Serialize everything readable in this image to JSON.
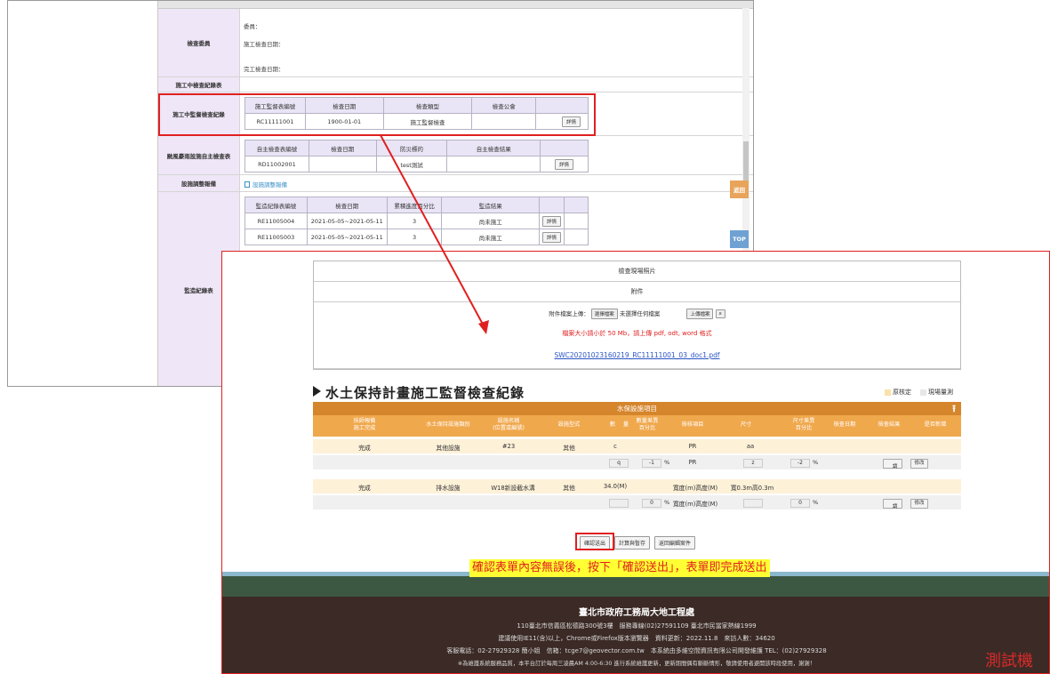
{
  "back": {
    "inspector_label": "檢查委員",
    "inspector_lines": [
      "委員：",
      "施工檢查日期：",
      "完工檢查日期："
    ],
    "construction_record_label": "施工中檢查紀錄表",
    "supervision_label": "施工中監督檢查紀錄",
    "supervision_headers": [
      "施工監督表編號",
      "檢查日期",
      "檢查類型",
      "檢查公會",
      ""
    ],
    "supervision_row": [
      "RC11111001",
      "1900-01-01",
      "施工監督檢查",
      "",
      "詳情"
    ],
    "disaster_label": "颱風豪雨設施自主檢查表",
    "disaster_headers": [
      "自主檢查表編號",
      "檢查日期",
      "防災標的",
      "自主檢查結果",
      ""
    ],
    "disaster_row": [
      "RD11002001",
      "",
      "test測試",
      "",
      "詳情"
    ],
    "adjust_label": "設施調整報備",
    "adjust_link": "設施調整報備",
    "monitor_label": "監造紀錄表",
    "monitor_headers": [
      "監造紀錄表編號",
      "檢查日期",
      "累積進度百分比",
      "監造結果",
      "",
      ""
    ],
    "monitor_rows": [
      [
        "RE11005004",
        "2021-05-05~2021-05-11",
        "3",
        "尚未施工",
        "詳情"
      ],
      [
        "RE11005003",
        "2021-05-05~2021-05-11",
        "3",
        "尚未施工",
        "詳情"
      ]
    ],
    "side_btn_top": "返回",
    "side_btn_bottom": "TOP"
  },
  "front": {
    "photo_row": "檢查現場照片",
    "attach_row": "附件",
    "upload_label": "附件檔案上傳：",
    "choose_btn": "選擇檔案",
    "no_file": "未選擇任何檔案",
    "upload_btn": "上傳檔案",
    "remove_btn": "x",
    "size_note": "檔案大小請小於 50 Mb，請上傳 pdf, odt, word 格式",
    "file_link": "SWC20201023160219_RC11111001_03_doc1.pdf",
    "section_title": "水土保持計畫施工監督檢查紀錄",
    "legend_items": [
      "原核定",
      "現場量測"
    ],
    "legend_colors": [
      "#f9e2a8",
      "#e7e7e7"
    ],
    "table_title": "水保設施項目",
    "headers": [
      "技師報備\n施工完成",
      "水土保持設施類別",
      "設施名稱\n(位置或編號)",
      "設施型式",
      "數",
      "量",
      "數量差異\n百分比",
      "檢核項目",
      "尺寸",
      "尺寸差異\n百分比",
      "檢查日期",
      "檢查結果",
      "是否新增"
    ],
    "rows": [
      {
        "done": "完成",
        "category": "其他設施",
        "name": "#23",
        "type": "其他",
        "qty": "c",
        "check_item": "PR",
        "size": "aa",
        "m_qty": "q",
        "m_qty_pct": "-1",
        "m_check": "PR",
        "m_size": "z",
        "m_size_pct": "-2",
        "m_result": "請",
        "edit": "修改"
      },
      {
        "done": "完成",
        "category": "排水設施",
        "name": "W18新設截水溝",
        "type": "其他",
        "qty": "34.0(M)",
        "check_item": "寬度(m)高度(M)",
        "size": "寬0.3m高0.3m",
        "m_qty": "",
        "m_qty_pct": "0",
        "m_check": "寬度(m)高度(M)",
        "m_size": "",
        "m_size_pct": "0",
        "m_result": "請",
        "edit": "修改"
      }
    ],
    "pct_sign": "%",
    "btn_confirm": "確認送出",
    "btn_save": "計算與暫存",
    "btn_back": "返回編輯案件",
    "caption": "確認表單內容無誤後，按下「確認送出」，表單即完成送出",
    "footer_title": "臺北市政府工務局大地工程處",
    "footer_lines": [
      "110臺北市信義區松德路300號3樓　服務專線(02)27591109 臺北市民當家熱線1999",
      "建議使用IE11(含)以上，Chrome或Firefox版本瀏覽器　資料更新：2022.11.8　來訪人數：34620",
      "客服電話：02-27929328 簡小姐　信箱：tcge7@geovector.com.tw　本系統由多維空間資訊有限公司開發維護 TEL：(02)27929328",
      "※為維護系統服務品質，本平台訂於每周三凌晨AM 4:00-6:30 進行系統維護更新，更新期間偶有斷斷情形，敬請使用者避開該時段使用，謝謝！"
    ],
    "watermark": "測試機"
  },
  "colors": {
    "accent_red": "#e02020",
    "orange": "#d5852b",
    "orange_light": "#f0a84d",
    "lavender": "#efe6f7"
  }
}
